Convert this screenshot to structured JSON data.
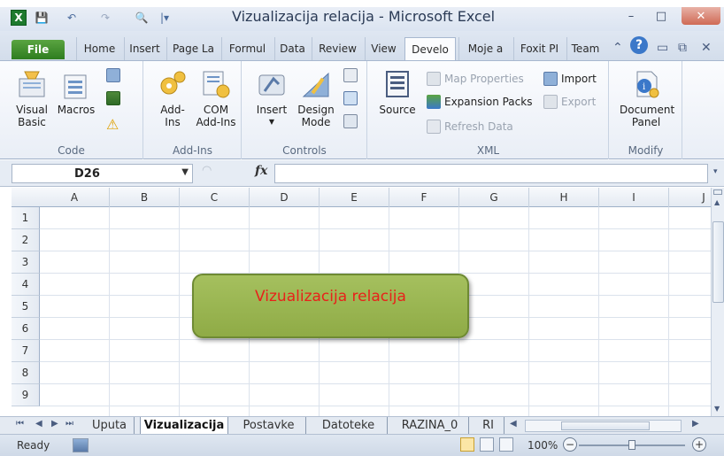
{
  "window": {
    "title": "Vizualizacija relacija - Microsoft Excel",
    "minimize": "–",
    "maximize": "□",
    "close": "✕"
  },
  "qat": {
    "app_icon": "X",
    "save": "💾",
    "undo": "↶",
    "redo": "↷",
    "print_preview": "🔍",
    "customize": "|▾"
  },
  "tabs": [
    "File",
    "Home",
    "Insert",
    "Page La",
    "Formul",
    "Data",
    "Review",
    "View",
    "Develo",
    "Moje a",
    "Foxit PI",
    "Team"
  ],
  "active_tab": "Develo",
  "ribbon": {
    "code": {
      "label": "Code",
      "visual_basic": "Visual Basic",
      "macros": "Macros"
    },
    "addins": {
      "label": "Add-Ins",
      "addins_btn": "Add-Ins",
      "com_addins": "COM Add-Ins"
    },
    "controls": {
      "label": "Controls",
      "insert": "Insert",
      "design_mode": "Design Mode"
    },
    "xml": {
      "label": "XML",
      "source": "Source",
      "map_properties": "Map Properties",
      "expansion_packs": "Expansion Packs",
      "refresh_data": "Refresh Data",
      "import": "Import",
      "export": "Export"
    },
    "modify": {
      "label": "Modify",
      "document_panel": "Document Panel"
    }
  },
  "formula_bar": {
    "name_box": "D26",
    "fx": "fx",
    "formula": ""
  },
  "grid": {
    "columns": [
      "A",
      "B",
      "C",
      "D",
      "E",
      "F",
      "G",
      "H",
      "I",
      "J"
    ],
    "rows": [
      "1",
      "2",
      "3",
      "4",
      "5",
      "6",
      "7",
      "8",
      "9"
    ]
  },
  "shape_text": "Vizualizacija relacija",
  "sheets": [
    "Uputa",
    "Vizualizacija",
    "Postavke",
    "Datoteke",
    "RAZINA_0",
    "RI"
  ],
  "active_sheet": "Vizualizacija",
  "status": {
    "ready": "Ready",
    "zoom": "100%",
    "zoom_minus": "−",
    "zoom_plus": "+",
    "zoom_fraction": 0.5
  }
}
